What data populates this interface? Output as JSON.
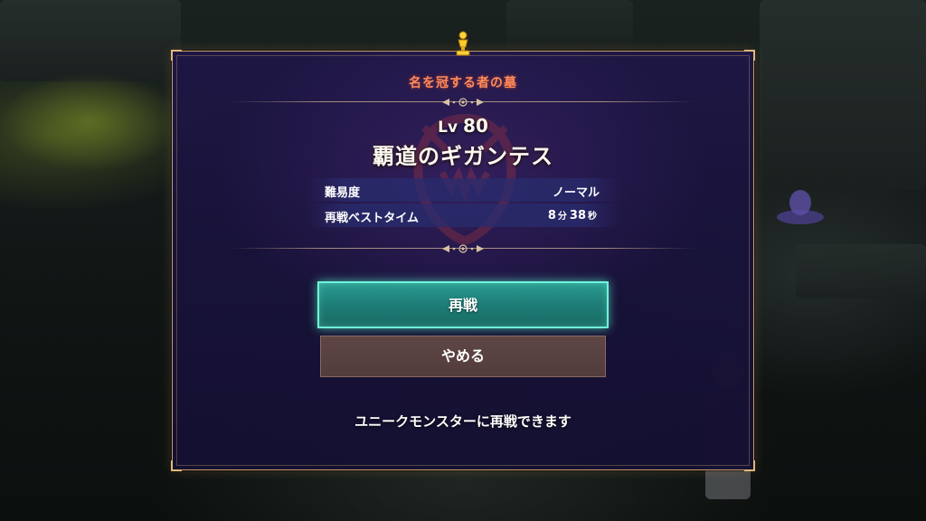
{
  "dialog": {
    "title": "名を冠する者の墓",
    "level_prefix": "Lv",
    "level_value": "80",
    "monster_name": "覇道のギガンテス",
    "stats": [
      {
        "label": "難易度",
        "value": "ノーマル"
      },
      {
        "label": "再戦ベストタイム",
        "minutes": "8",
        "minutes_unit": "分",
        "seconds": "38",
        "seconds_unit": "秒"
      }
    ],
    "buttons": {
      "retry_label": "再戦",
      "cancel_label": "やめる"
    },
    "footer_note": "ユニークモンスターに再戦できます"
  },
  "icons": {
    "top": "trophy-icon",
    "divider": "ornament-icon",
    "background_emblem": "monster-emblem-icon"
  },
  "colors": {
    "title": "#ff8a5a",
    "frame": "#c9a06a",
    "retry_button": "#1d7d76",
    "retry_glow": "#6ff5d8",
    "cancel_button": "#5e4646"
  }
}
